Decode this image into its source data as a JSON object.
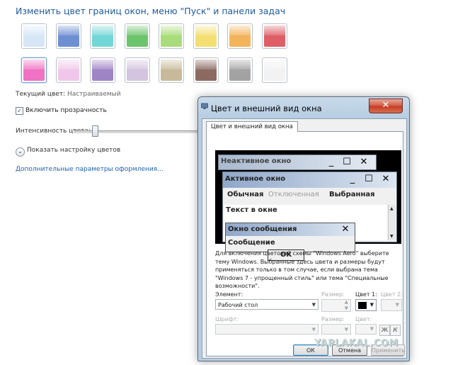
{
  "header": {
    "title": "Изменить цвет границ окон, меню \"Пуск\" и панели задач"
  },
  "swatches": [
    {
      "name": "sky",
      "color": "#d6e6f7"
    },
    {
      "name": "twilight",
      "color": "#6f8fd3"
    },
    {
      "name": "sea",
      "color": "#72d6d6"
    },
    {
      "name": "leaf",
      "color": "#6cc56c"
    },
    {
      "name": "lime",
      "color": "#a9dc7a"
    },
    {
      "name": "lemon",
      "color": "#f3df72"
    },
    {
      "name": "pumpkin",
      "color": "#f3b35b"
    },
    {
      "name": "ruby",
      "color": "#de5f66"
    },
    {
      "name": "fuchsia",
      "color": "#ef72c3"
    },
    {
      "name": "blush",
      "color": "#f0c7ea"
    },
    {
      "name": "violet",
      "color": "#9f85c6"
    },
    {
      "name": "lavender",
      "color": "#d3c4df"
    },
    {
      "name": "taupe",
      "color": "#c8b99a"
    },
    {
      "name": "chocolate",
      "color": "#8c6a62"
    },
    {
      "name": "slate",
      "color": "#a3a3a3"
    },
    {
      "name": "frost",
      "color": "#f2f2f2"
    }
  ],
  "current_color": {
    "label": "Текущий цвет:",
    "value": "Настраиваемый"
  },
  "transparency": {
    "label": "Включить прозрачность",
    "checked": true
  },
  "intensity": {
    "label": "Интенсивность цвета:",
    "value_fraction": 0.15
  },
  "show_mixer": {
    "label": "Показать настройку цветов"
  },
  "advanced_link": {
    "label": "Дополнительные параметры оформления..."
  },
  "dialog": {
    "title": "Цвет и внешний вид окна",
    "close_label": "✕",
    "tab": "Цвет и внешний вид окна",
    "preview": {
      "inactive_title": "Неактивное окно",
      "active_title": "Активное окно",
      "menu": [
        "Обычная",
        "Отключенная",
        "Выбранная"
      ],
      "window_text": "Текст в окне",
      "msgbox_title": "Окно сообщения",
      "msgbox_text": "Сообщение",
      "ok": "OK"
    },
    "description": "Для включения цветовой схемы \"Windows Aero\" выберите тему Windows.  Выбранные здесь цвета и размеры будут применяться только в том случае, если выбрана тема \"Windows 7 - упрощенный стиль\" или тема \"Специальные возможности\".",
    "element_label": "Элемент:",
    "element_value": "Рабочий стол",
    "size_label": "Размер:",
    "color1_label": "Цвет 1:",
    "color2_label": "Цвет 2:",
    "font_label": "Шрифт:",
    "font_size_label": "Размер:",
    "font_color_label": "Цвет:",
    "bold_label": "Ж",
    "italic_label": "К",
    "color1_value": "#000000",
    "buttons": {
      "ok": "ОК",
      "cancel": "Отмена",
      "apply": "Применить"
    }
  },
  "watermark": "YAPLAKAL.COM"
}
